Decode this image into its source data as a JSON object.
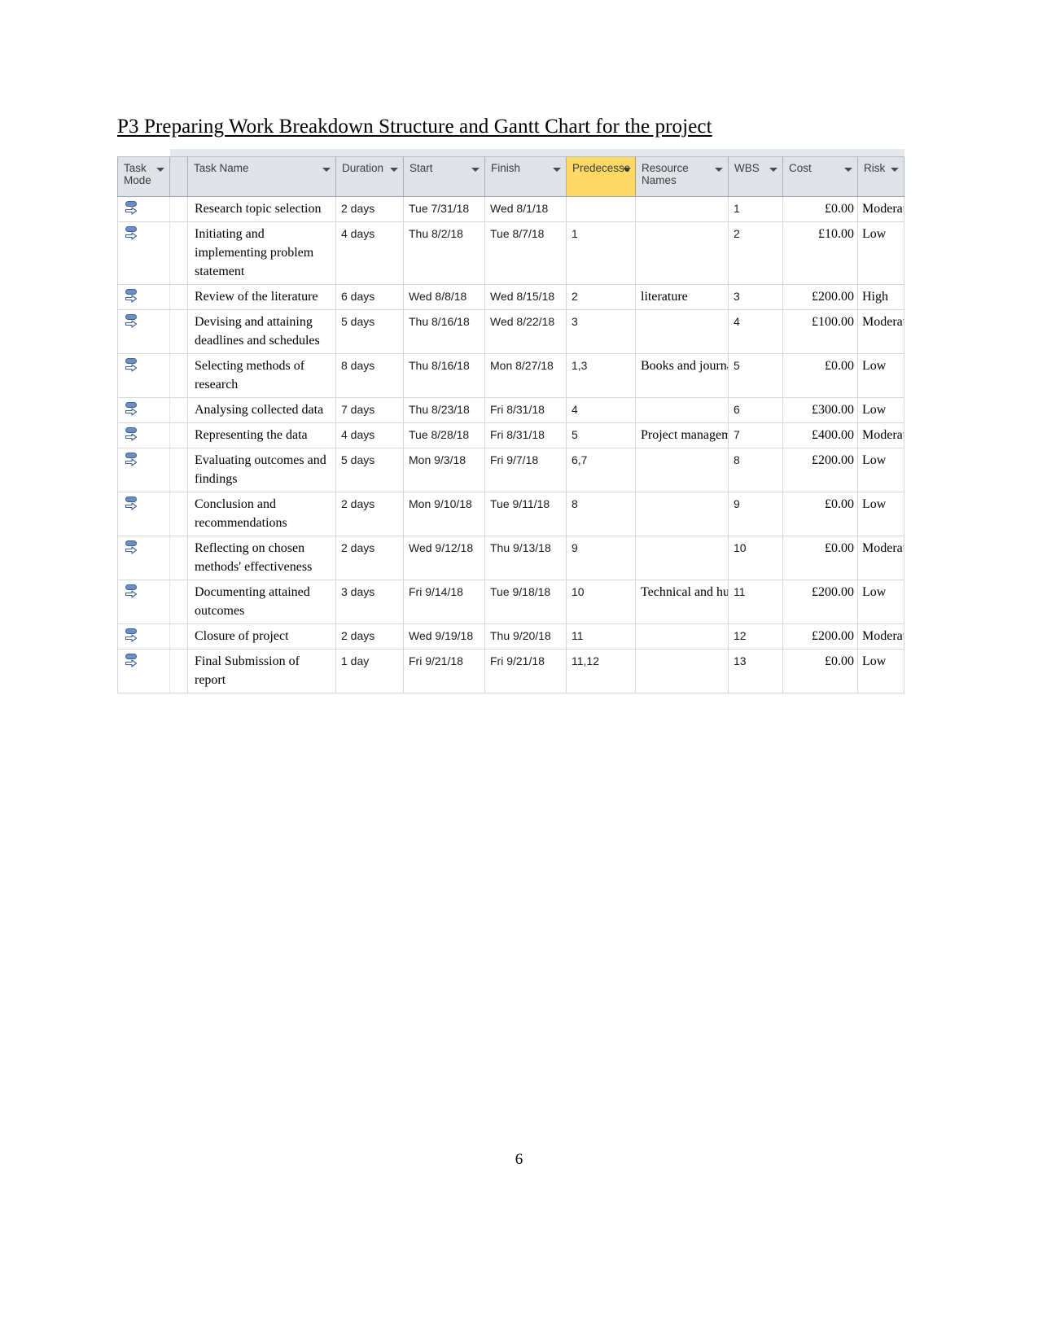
{
  "document": {
    "heading": "P3 Preparing Work Breakdown Structure and Gantt Chart for the project",
    "page_number": "6"
  },
  "table": {
    "accent_header_color": "#ffd966",
    "header_color": "#dfe3e8",
    "columns": [
      {
        "key": "task_mode",
        "label": "Task\nMode",
        "filter": true,
        "highlight": false
      },
      {
        "key": "spacer",
        "label": "",
        "filter": false,
        "highlight": false
      },
      {
        "key": "task_name",
        "label": "Task Name",
        "filter": true,
        "highlight": false
      },
      {
        "key": "duration",
        "label": "Duration",
        "filter": true,
        "highlight": false
      },
      {
        "key": "start",
        "label": "Start",
        "filter": true,
        "highlight": false
      },
      {
        "key": "finish",
        "label": "Finish",
        "filter": true,
        "highlight": false
      },
      {
        "key": "predecessors",
        "label": "Predecessc",
        "filter": true,
        "highlight": true
      },
      {
        "key": "resource_names",
        "label": "Resource\nNames",
        "filter": true,
        "highlight": false
      },
      {
        "key": "wbs",
        "label": "WBS",
        "filter": true,
        "highlight": false
      },
      {
        "key": "cost",
        "label": "Cost",
        "filter": true,
        "highlight": false
      },
      {
        "key": "risk",
        "label": "Risk",
        "filter": true,
        "highlight": false
      }
    ],
    "rows": [
      {
        "task_mode_icon": "auto-scheduled-icon",
        "task_name": "Research topic selection",
        "duration": "2 days",
        "start": "Tue 7/31/18",
        "finish": "Wed 8/1/18",
        "predecessors": "",
        "resource_names": "",
        "wbs": "1",
        "cost": "£0.00",
        "risk": "Moderate"
      },
      {
        "task_mode_icon": "auto-scheduled-icon",
        "task_name": "Initiating and implementing problem statement",
        "duration": "4 days",
        "start": "Thu 8/2/18",
        "finish": "Tue 8/7/18",
        "predecessors": "1",
        "resource_names": "",
        "wbs": "2",
        "cost": "£10.00",
        "risk": "Low"
      },
      {
        "task_mode_icon": "auto-scheduled-icon",
        "task_name": "Review of the literature",
        "duration": "6 days",
        "start": "Wed 8/8/18",
        "finish": "Wed 8/15/18",
        "predecessors": "2",
        "resource_names": "literature",
        "wbs": "3",
        "cost": "£200.00",
        "risk": "High"
      },
      {
        "task_mode_icon": "auto-scheduled-icon",
        "task_name": "Devising and attaining deadlines and schedules",
        "duration": "5 days",
        "start": "Thu 8/16/18",
        "finish": "Wed 8/22/18",
        "predecessors": "3",
        "resource_names": "",
        "wbs": "4",
        "cost": "£100.00",
        "risk": "Moderate"
      },
      {
        "task_mode_icon": "auto-scheduled-icon",
        "task_name": "Selecting methods of research",
        "duration": "8 days",
        "start": "Thu 8/16/18",
        "finish": "Mon 8/27/18",
        "predecessors": "1,3",
        "resource_names": "Books and journals,articles",
        "wbs": "5",
        "cost": "£0.00",
        "risk": "Low"
      },
      {
        "task_mode_icon": "auto-scheduled-icon",
        "task_name": "Analysing collected data",
        "duration": "7 days",
        "start": "Thu 8/23/18",
        "finish": "Fri 8/31/18",
        "predecessors": "4",
        "resource_names": "",
        "wbs": "6",
        "cost": "£300.00",
        "risk": "Low"
      },
      {
        "task_mode_icon": "auto-scheduled-icon",
        "task_name": "Representing the data",
        "duration": "4 days",
        "start": "Tue 8/28/18",
        "finish": "Fri 8/31/18",
        "predecessors": "5",
        "resource_names": "Project managem",
        "wbs": "7",
        "cost": "£400.00",
        "risk": "Moderate"
      },
      {
        "task_mode_icon": "auto-scheduled-icon",
        "task_name": "Evaluating outcomes and findings",
        "duration": "5 days",
        "start": "Mon 9/3/18",
        "finish": "Fri 9/7/18",
        "predecessors": "6,7",
        "resource_names": "",
        "wbs": "8",
        "cost": "£200.00",
        "risk": "Low"
      },
      {
        "task_mode_icon": "auto-scheduled-icon",
        "task_name": "Conclusion and recommendations",
        "duration": "2 days",
        "start": "Mon 9/10/18",
        "finish": "Tue 9/11/18",
        "predecessors": "8",
        "resource_names": "",
        "wbs": "9",
        "cost": "£0.00",
        "risk": "Low"
      },
      {
        "task_mode_icon": "auto-scheduled-icon",
        "task_name": "Reflecting on chosen methods' effectiveness",
        "duration": "2 days",
        "start": "Wed 9/12/18",
        "finish": "Thu 9/13/18",
        "predecessors": "9",
        "resource_names": "",
        "wbs": "10",
        "cost": "£0.00",
        "risk": "Moderate"
      },
      {
        "task_mode_icon": "auto-scheduled-icon",
        "task_name": "Documenting attained outcomes",
        "duration": "3 days",
        "start": "Fri 9/14/18",
        "finish": "Tue 9/18/18",
        "predecessors": "10",
        "resource_names": "Technical and human resources",
        "wbs": "11",
        "cost": "£200.00",
        "risk": "Low"
      },
      {
        "task_mode_icon": "auto-scheduled-icon",
        "task_name": "Closure of project",
        "duration": "2 days",
        "start": "Wed 9/19/18",
        "finish": "Thu 9/20/18",
        "predecessors": "11",
        "resource_names": "",
        "wbs": "12",
        "cost": "£200.00",
        "risk": "Moderate"
      },
      {
        "task_mode_icon": "auto-scheduled-icon",
        "task_name": "Final Submission of report",
        "duration": "1 day",
        "start": "Fri 9/21/18",
        "finish": "Fri 9/21/18",
        "predecessors": "11,12",
        "resource_names": "",
        "wbs": "13",
        "cost": "£0.00",
        "risk": "Low"
      }
    ]
  }
}
